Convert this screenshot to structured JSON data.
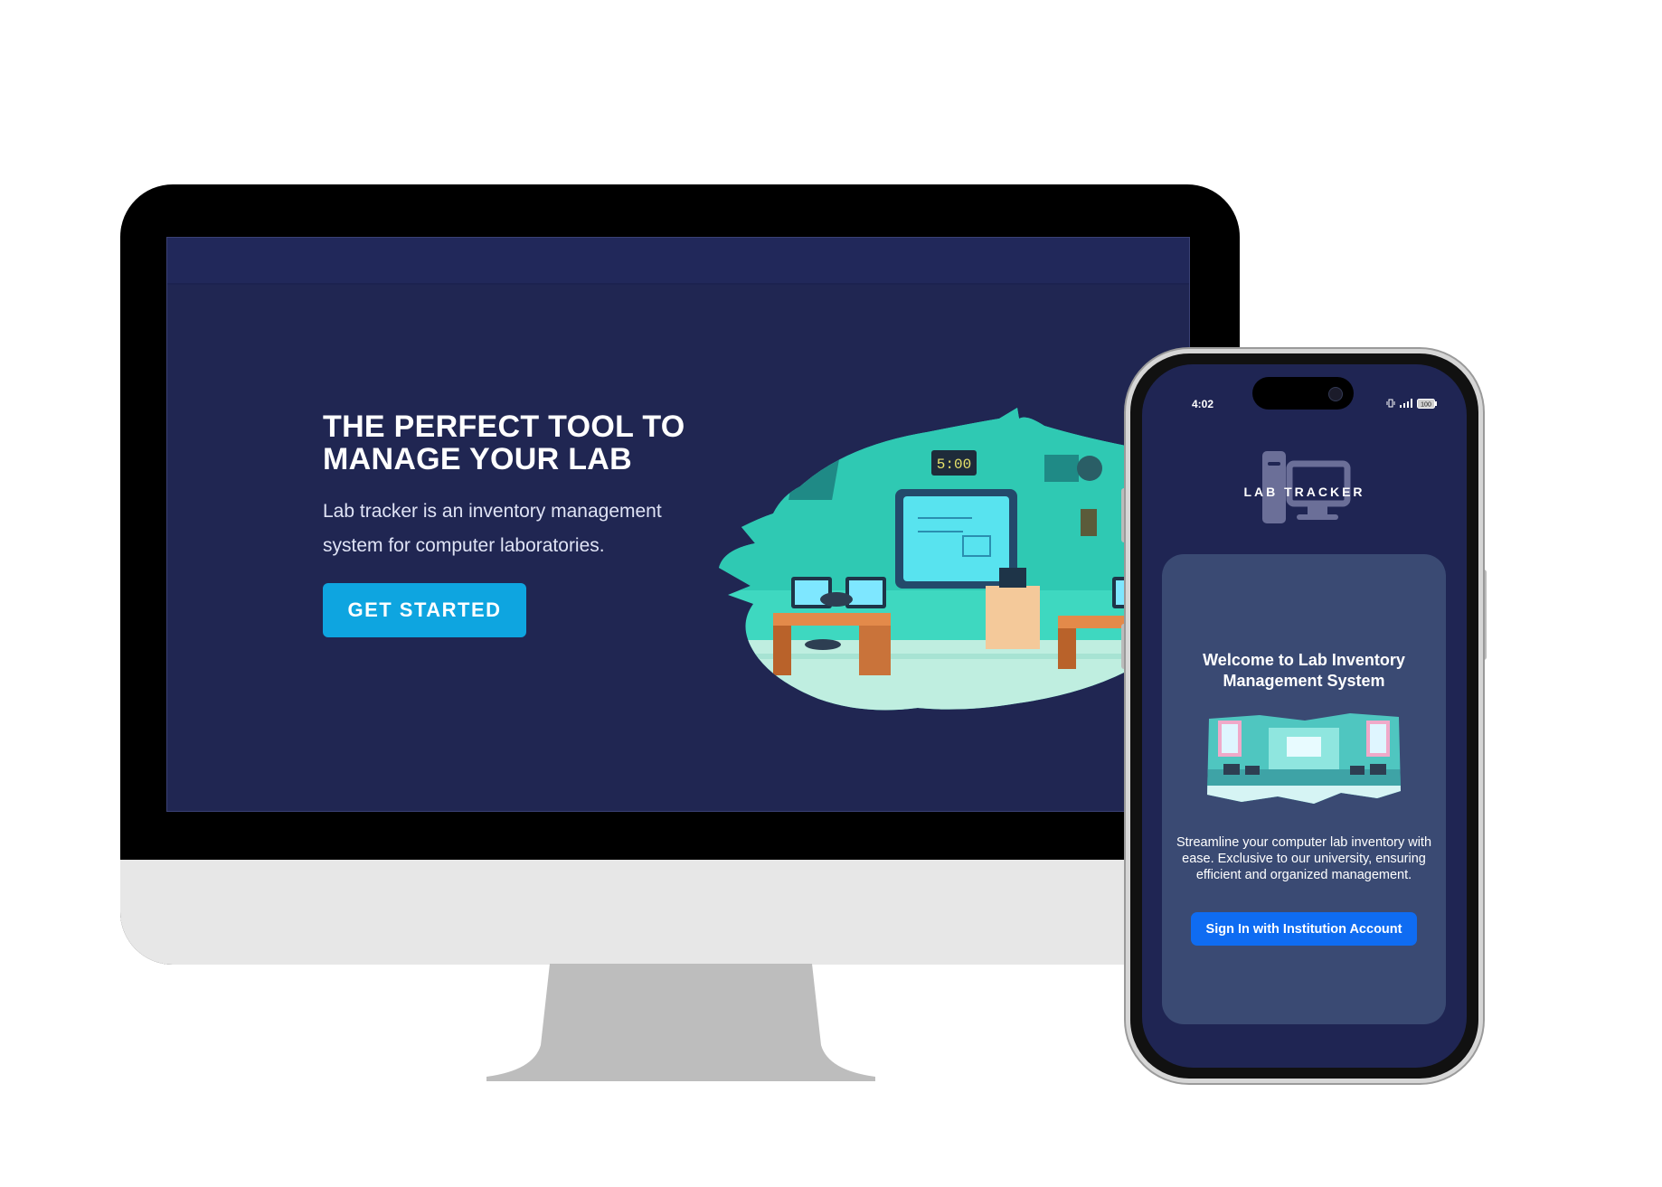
{
  "desktop": {
    "hero": {
      "title": "THE PERFECT TOOL TO MANAGE YOUR LAB",
      "description": "Lab tracker is an inventory management system for computer laboratories.",
      "cta_label": "GET STARTED"
    },
    "illustration": {
      "clock_text": "5:00"
    }
  },
  "mobile": {
    "status_bar": {
      "time": "4:02",
      "battery": "100"
    },
    "logo_text": "LAB TRACKER",
    "card": {
      "title": "Welcome to Lab Inventory Management System",
      "description": "Streamline your computer lab inventory with ease. Exclusive to our university, ensuring efficient and organized management.",
      "sign_in_label": "Sign In with Institution Account"
    }
  },
  "colors": {
    "screen_bg": "#202652",
    "cta_blue": "#0ea5e0",
    "card_bg": "#3a4a73",
    "sign_in_blue": "#0f6cf2",
    "illustration_teal": "#3ed8c0"
  },
  "icons": [
    "computer-logo-icon",
    "vibrate-icon",
    "signal-icon",
    "battery-icon"
  ]
}
